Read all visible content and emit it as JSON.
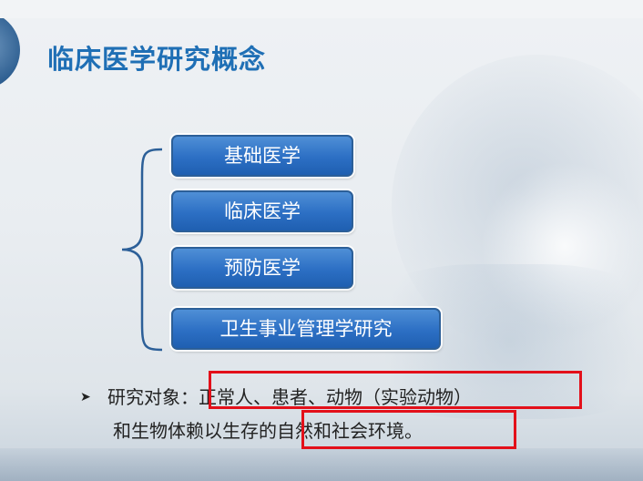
{
  "slide": {
    "title": "临床医学研究概念",
    "categories": [
      "基础医学",
      "临床医学",
      "预防医学",
      "卫生事业管理学研究"
    ],
    "research_line1": "研究对象：正常人、患者、动物（实验动物）",
    "research_line2": "和生物体赖以生存的自然和社会环境。"
  },
  "colors": {
    "title": "#1f6fb5",
    "box_fill": "#2c6fc4",
    "highlight": "#e3101a"
  },
  "icons": {
    "bullet": "arrowhead-bullet-icon",
    "brace": "left-curly-brace"
  }
}
